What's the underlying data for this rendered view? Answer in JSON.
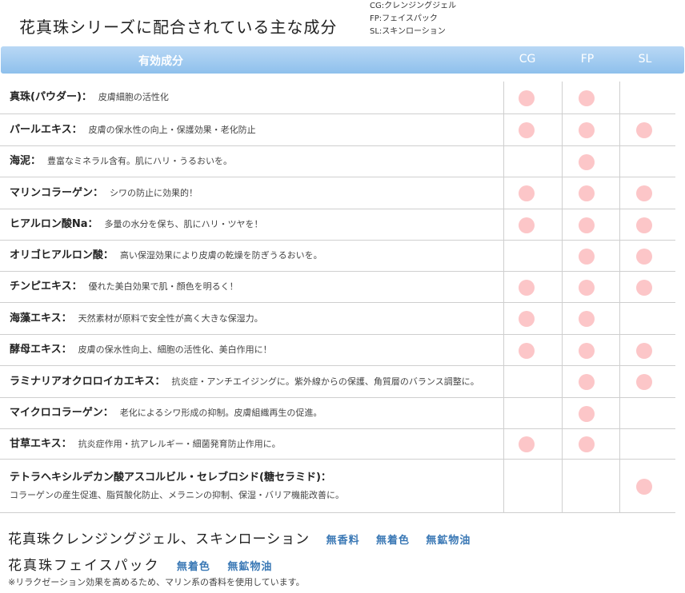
{
  "title": "花真珠シリーズに配合されている主な成分",
  "legend": [
    "CG:クレンジングジェル",
    "FP:フェイスパック",
    "SL:スキンローション"
  ],
  "header": {
    "ingredient": "有効成分",
    "cols": [
      "CG",
      "FP",
      "SL"
    ]
  },
  "rows": [
    {
      "name": "真珠(パウダー)：",
      "desc": "皮膚細胞の活性化",
      "cg": true,
      "fp": true,
      "sl": false
    },
    {
      "name": "パールエキス：",
      "desc": "皮膚の保水性の向上・保護効果・老化防止",
      "cg": true,
      "fp": true,
      "sl": true
    },
    {
      "name": "海泥：",
      "desc": "豊富なミネラル含有。肌にハリ・うるおいを。",
      "cg": false,
      "fp": true,
      "sl": false
    },
    {
      "name": "マリンコラーゲン：",
      "desc": "シワの防止に効果的！",
      "cg": true,
      "fp": true,
      "sl": true
    },
    {
      "name": "ヒアルロン酸Na：",
      "desc": "多量の水分を保ち、肌にハリ・ツヤを！",
      "cg": true,
      "fp": true,
      "sl": true
    },
    {
      "name": "オリゴヒアルロン酸：",
      "desc": "高い保湿効果により皮膚の乾燥を防ぎうるおいを。",
      "cg": false,
      "fp": true,
      "sl": true
    },
    {
      "name": "チンピエキス：",
      "desc": "優れた美白効果で肌・顔色を明るく！",
      "cg": true,
      "fp": true,
      "sl": true
    },
    {
      "name": "海藻エキス：",
      "desc": "天然素材が原料で安全性が高く大きな保湿力。",
      "cg": true,
      "fp": true,
      "sl": false
    },
    {
      "name": "酵母エキス：",
      "desc": "皮膚の保水性向上、細胞の活性化、美白作用に！",
      "cg": true,
      "fp": true,
      "sl": true
    },
    {
      "name": "ラミナリアオクロロイカエキス：",
      "desc": "抗炎症・アンチエイジングに。紫外線からの保護、角質層のバランス調整に。",
      "cg": false,
      "fp": true,
      "sl": true
    },
    {
      "name": "マイクロコラーゲン：",
      "desc": "老化によるシワ形成の抑制。皮膚組織再生の促進。",
      "cg": false,
      "fp": true,
      "sl": false
    },
    {
      "name": "甘草エキス：",
      "desc": "抗炎症作用・抗アレルギー・細菌発育防止作用に。",
      "cg": true,
      "fp": true,
      "sl": false
    },
    {
      "name": "テトラヘキシルデカン酸アスコルビル・セレブロシド(糖セラミド)：",
      "desc": "コラーゲンの産生促進、脂質酸化防止、メラニンの抑制、保湿・バリア機能改善に。",
      "cg": false,
      "fp": false,
      "sl": true
    }
  ],
  "footer": {
    "line1": "花真珠クレンジングジェル、スキンローション",
    "line1_tags": [
      "無香料",
      "無着色",
      "無鉱物油"
    ],
    "line2": "花真珠フェイスパック",
    "line2_tags": [
      "無着色",
      "無鉱物油"
    ],
    "note": "※リラクゼーション効果を高めるため、マリン系の香料を使用しています。"
  },
  "colors": {
    "header_top": "#b9d8f5",
    "header_bottom": "#8ec0ec",
    "dot": "#fcc6c8",
    "tag": "#3a78b5"
  }
}
